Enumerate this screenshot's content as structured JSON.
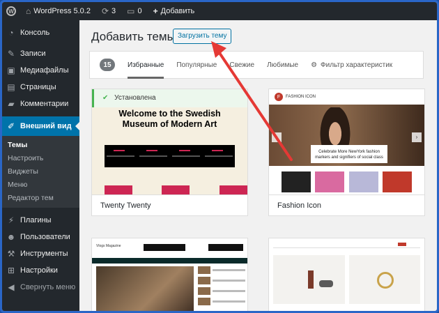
{
  "adminbar": {
    "site_name": "WordPress 5.0.2",
    "updates_count": "3",
    "comments_count": "0",
    "add_label": "Добавить"
  },
  "sidebar": {
    "items": [
      {
        "label": "Консоль",
        "icon": "dashboard-icon"
      },
      {
        "label": "Записи",
        "icon": "pin-icon"
      },
      {
        "label": "Медиафайлы",
        "icon": "media-icon"
      },
      {
        "label": "Страницы",
        "icon": "page-icon"
      },
      {
        "label": "Комментарии",
        "icon": "comment-icon"
      },
      {
        "label": "Внешний вид",
        "icon": "brush-icon"
      },
      {
        "label": "Плагины",
        "icon": "plugin-icon"
      },
      {
        "label": "Пользователи",
        "icon": "users-icon"
      },
      {
        "label": "Инструменты",
        "icon": "wrench-icon"
      },
      {
        "label": "Настройки",
        "icon": "settings-icon"
      },
      {
        "label": "Свернуть меню",
        "icon": "collapse-icon"
      }
    ],
    "submenu": [
      "Темы",
      "Настроить",
      "Виджеты",
      "Меню",
      "Редактор тем"
    ]
  },
  "main": {
    "title": "Добавить темы",
    "upload_button": "Загрузить тему"
  },
  "filterbar": {
    "count": "15",
    "tabs": [
      "Избранные",
      "Популярные",
      "Свежие",
      "Любимые"
    ],
    "feature_filter": "Фильтр характеристик"
  },
  "themes": [
    {
      "name": "Twenty Twenty",
      "installed_label": "Установлена",
      "headline_line1": "Welcome to the Swedish",
      "headline_line2": "Museum of Modern Art"
    },
    {
      "name": "Fashion Icon",
      "brand": "FASHION ICON",
      "hero_text_line1": "Celebrate More NewYork fashion",
      "hero_text_line2": "markers and signifiers of social class"
    },
    {
      "name": "",
      "brand": "Vlogs Magazine"
    },
    {
      "name": ""
    }
  ],
  "colors": {
    "adminbar": "#23282d",
    "accent": "#0073aa",
    "installed": "#46b450",
    "arrow": "#e53935"
  }
}
